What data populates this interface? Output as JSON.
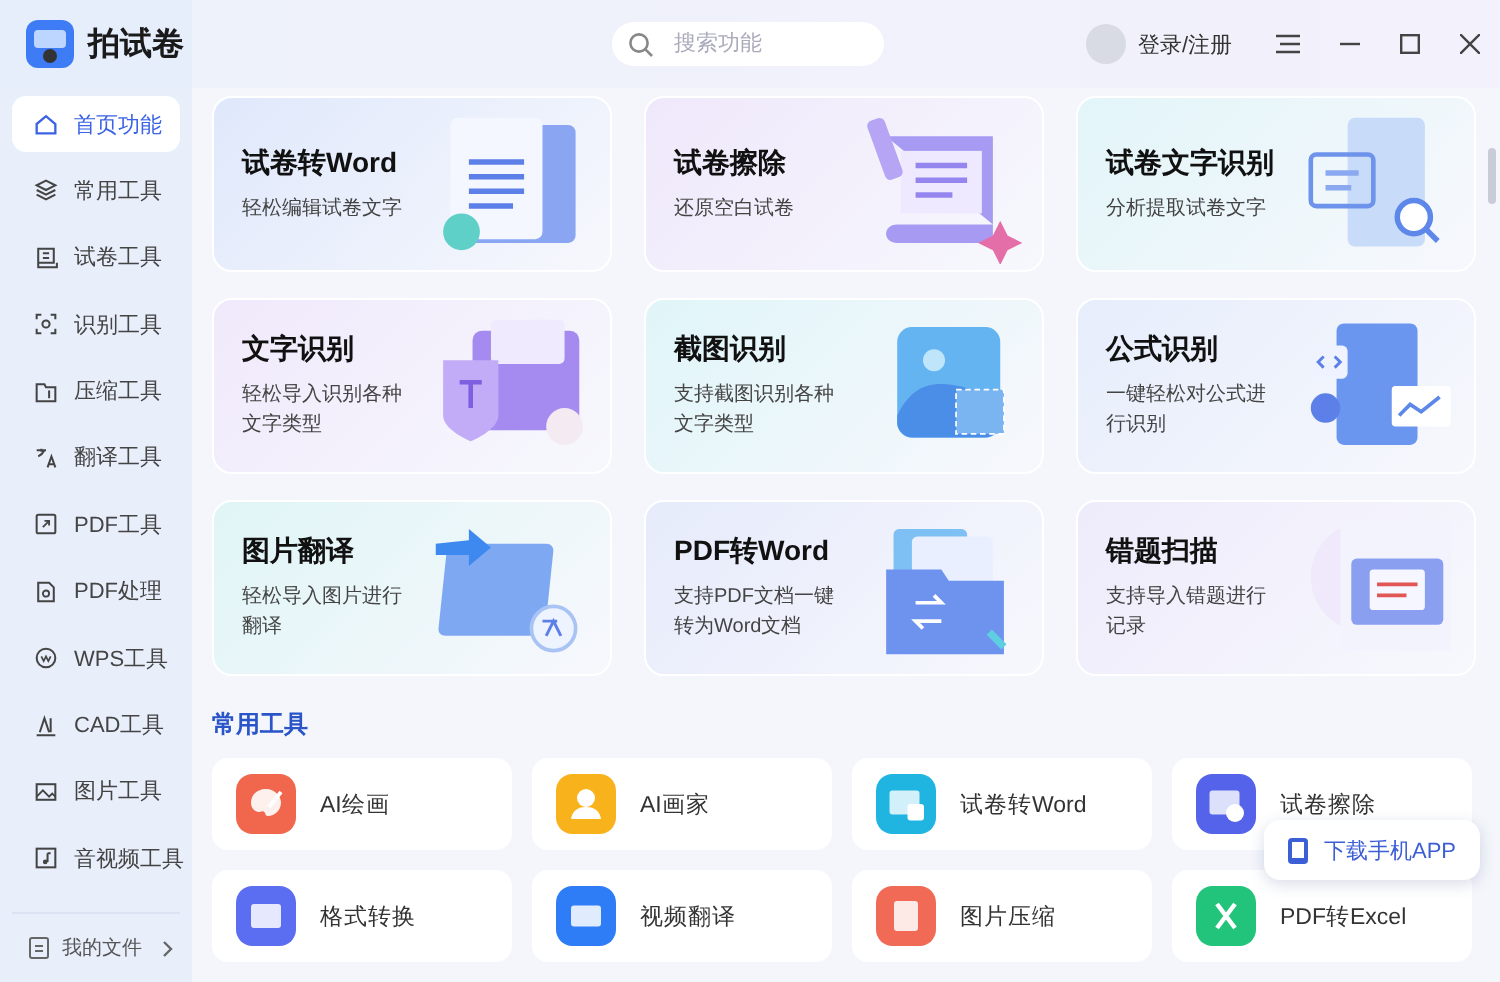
{
  "app": {
    "name": "拍试卷"
  },
  "search": {
    "placeholder": "搜索功能"
  },
  "user": {
    "login": "登录/注册"
  },
  "sidebar": {
    "items": [
      {
        "label": "首页功能",
        "kind": "home",
        "selected": true
      },
      {
        "label": "常用工具",
        "kind": "layers",
        "selected": false
      },
      {
        "label": "试卷工具",
        "kind": "paper",
        "selected": false
      },
      {
        "label": "识别工具",
        "kind": "scan",
        "selected": false
      },
      {
        "label": "压缩工具",
        "kind": "folder",
        "selected": false
      },
      {
        "label": "翻译工具",
        "kind": "translate",
        "selected": false
      },
      {
        "label": "PDF工具",
        "kind": "pdf",
        "selected": false
      },
      {
        "label": "PDF处理",
        "kind": "pdfedit",
        "selected": false
      },
      {
        "label": "WPS工具",
        "kind": "wps",
        "selected": false
      },
      {
        "label": "CAD工具",
        "kind": "cad",
        "selected": false
      },
      {
        "label": "图片工具",
        "kind": "image",
        "selected": false
      },
      {
        "label": "音视频工具",
        "kind": "media",
        "selected": false
      }
    ],
    "footer": {
      "label": "我的文件"
    }
  },
  "features": [
    {
      "title": "试卷转Word",
      "subtitle": "轻松编辑试卷文字",
      "kind": "word",
      "color": "#dfe8fb"
    },
    {
      "title": "试卷擦除",
      "subtitle": "还原空白试卷",
      "kind": "erase",
      "color": "#efe8fb"
    },
    {
      "title": "试卷文字识别",
      "subtitle": "分析提取试卷文字",
      "kind": "ocr",
      "color": "#e2f5f8"
    },
    {
      "title": "文字识别",
      "subtitle": "轻松导入识别各种文字类型",
      "kind": "text",
      "color": "#f0e9fb"
    },
    {
      "title": "截图识别",
      "subtitle": "支持截图识别各种文字类型",
      "kind": "shot",
      "color": "#e0f5f8"
    },
    {
      "title": "公式识别",
      "subtitle": "一键轻松对公式进行识别",
      "kind": "formula",
      "color": "#e6edfb"
    },
    {
      "title": "图片翻译",
      "subtitle": "轻松导入图片进行翻译",
      "kind": "translate",
      "color": "#e0f5f6"
    },
    {
      "title": "PDF转Word",
      "subtitle": "支持PDF文档一键转为Word文档",
      "kind": "pdf",
      "color": "#e6ebfb"
    },
    {
      "title": "错题扫描",
      "subtitle": "支持导入错题进行记录",
      "kind": "mistake",
      "color": "#eeebfb"
    }
  ],
  "section": {
    "title": "常用工具"
  },
  "tools": [
    {
      "label": "AI绘画",
      "kind": "palette",
      "color": "#f0674e"
    },
    {
      "label": "AI画家",
      "kind": "person",
      "color": "#f7b21c"
    },
    {
      "label": "试卷转Word",
      "kind": "word",
      "color": "#1fb5e0"
    },
    {
      "label": "试卷擦除",
      "kind": "erase",
      "color": "#5563ea"
    },
    {
      "label": "格式转换",
      "kind": "convert",
      "color": "#5b6df0"
    },
    {
      "label": "视频翻译",
      "kind": "video",
      "color": "#2e7cf6"
    },
    {
      "label": "图片压缩",
      "kind": "compress",
      "color": "#f06a55"
    },
    {
      "label": "PDF转Excel",
      "kind": "excel",
      "color": "#22c37a"
    }
  ],
  "download": {
    "label": "下载手机APP"
  }
}
